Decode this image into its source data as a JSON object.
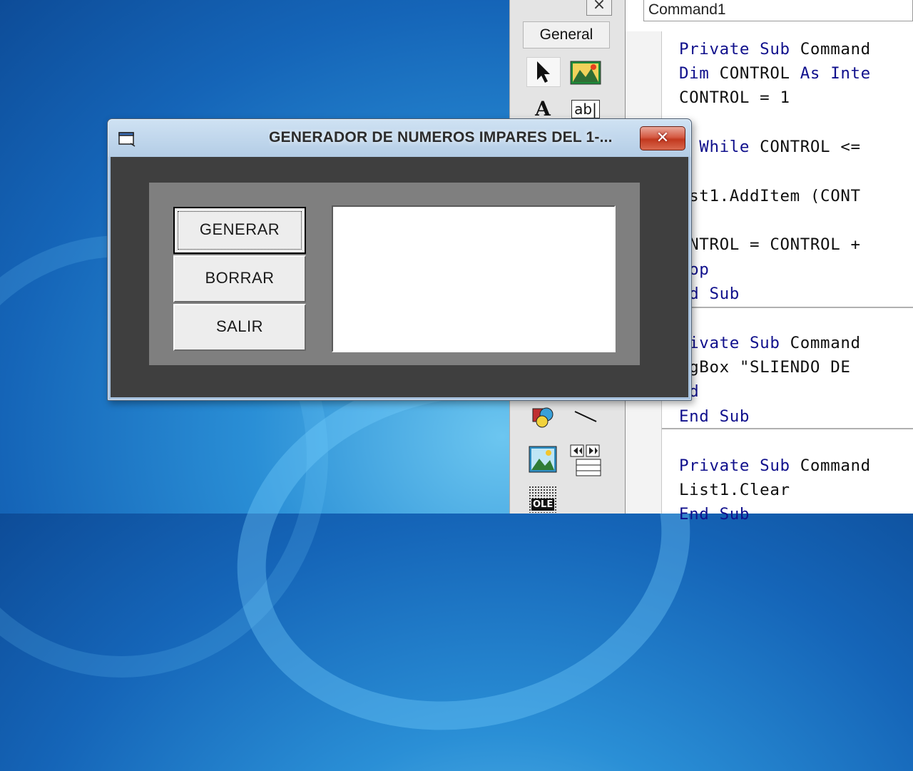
{
  "ide": {
    "toolbox": {
      "tab_label": "General",
      "close_glyph": "×",
      "tools": [
        {
          "name": "pointer-icon"
        },
        {
          "name": "picturebox-icon"
        },
        {
          "name": "label-icon",
          "glyph": "A"
        },
        {
          "name": "textbox-icon",
          "glyph": "ab|"
        },
        {
          "name": "shape-icon"
        },
        {
          "name": "line-icon"
        },
        {
          "name": "image-icon"
        },
        {
          "name": "data-icon"
        },
        {
          "name": "ole-icon",
          "glyph": "OLE"
        }
      ]
    },
    "code_window": {
      "object_combo": "Command1",
      "lines": [
        {
          "tokens": [
            {
              "t": "Private Sub ",
              "kw": true
            },
            {
              "t": "Command"
            }
          ]
        },
        {
          "tokens": [
            {
              "t": "Dim ",
              "kw": true
            },
            {
              "t": "CONTROL "
            },
            {
              "t": "As Inte",
              "kw": true
            }
          ]
        },
        {
          "tokens": [
            {
              "t": "CONTROL = 1"
            }
          ]
        },
        {
          "tokens": [
            {
              "t": "o While ",
              "kw": true
            },
            {
              "t": "CONTROL <="
            }
          ]
        },
        {
          "tokens": [
            {
              "t": "ist1.AddItem (CONT"
            }
          ]
        },
        {
          "tokens": [
            {
              "t": "ONTROL = CONTROL +"
            }
          ]
        },
        {
          "tokens": [
            {
              "t": "oop",
              "kw": true
            }
          ]
        },
        {
          "tokens": [
            {
              "t": "nd Sub",
              "kw": true
            }
          ]
        },
        {
          "tokens": [
            {
              "t": "rivate Sub ",
              "kw": true
            },
            {
              "t": "Command"
            }
          ]
        },
        {
          "tokens": [
            {
              "t": "sgBox \"SLIENDO DE "
            }
          ]
        },
        {
          "tokens": [
            {
              "t": "nd",
              "kw": true
            }
          ]
        },
        {
          "tokens": [
            {
              "t": "End Sub",
              "kw": true
            }
          ]
        },
        {
          "tokens": [
            {
              "t": "Private Sub ",
              "kw": true
            },
            {
              "t": "Command"
            }
          ]
        },
        {
          "tokens": [
            {
              "t": "List1.Clear"
            }
          ]
        },
        {
          "tokens": [
            {
              "t": "End Sub",
              "kw": true
            }
          ]
        }
      ]
    }
  },
  "form": {
    "title": "GENERADOR DE NUMEROS IMPARES DEL 1-...",
    "close_glyph": "✕",
    "buttons": {
      "generar": "GENERAR",
      "borrar": "BORRAR",
      "salir": "SALIR"
    },
    "list_items": []
  }
}
